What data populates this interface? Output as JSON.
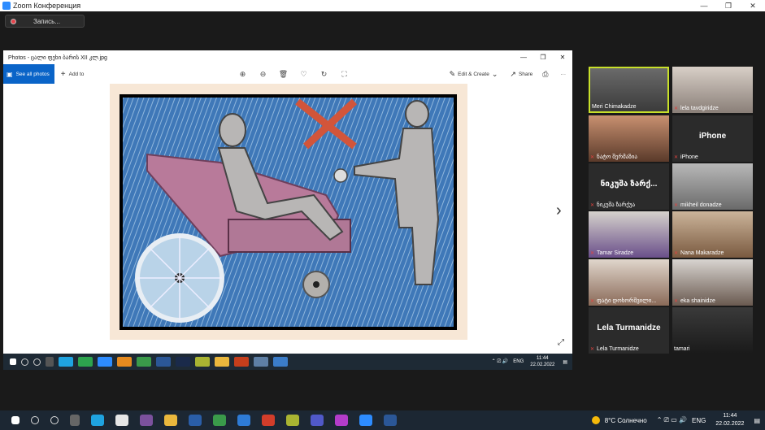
{
  "zoom": {
    "title": "Zoom Конференция",
    "record_label": "Запись...",
    "window_controls": [
      "—",
      "❐",
      "✕"
    ]
  },
  "photos": {
    "title": "Photos - ცალი ფეხი ბარის XII კლ.jpg",
    "window_controls": [
      "—",
      "❐",
      "✕"
    ],
    "see_all_label": "See all photos",
    "add_to_label": "Add to",
    "edit_create_label": "Edit & Create",
    "share_label": "Share",
    "more_label": "···"
  },
  "inner_taskbar": {
    "lang": "ENG",
    "time": "11:44",
    "date": "22.02.2022"
  },
  "participants": [
    {
      "name": "Meri Chimakadze",
      "muted": false,
      "active": true,
      "video": true
    },
    {
      "name": "lela tavdgiridze",
      "muted": true,
      "active": false,
      "video": true
    },
    {
      "name": "ნატო შერმაზია",
      "muted": true,
      "active": false,
      "video": true
    },
    {
      "name": "iPhone",
      "big_label": "iPhone",
      "muted": true,
      "active": false,
      "video": false
    },
    {
      "name": "ნიკუშა ზარქუა",
      "big_label": "ნიკუშა ზარქ...",
      "muted": true,
      "active": false,
      "video": false
    },
    {
      "name": "mikheil donadze",
      "muted": true,
      "active": false,
      "video": true
    },
    {
      "name": "Tamar Siradze",
      "muted": true,
      "active": false,
      "video": true
    },
    {
      "name": "Nana Makaradze",
      "muted": true,
      "active": false,
      "video": true
    },
    {
      "name": "ფატი დოხორშვილი...",
      "muted": true,
      "active": false,
      "video": true
    },
    {
      "name": "eka shainidze",
      "muted": true,
      "active": false,
      "video": true
    },
    {
      "name": "Lela Turmanidze",
      "big_label": "Lela Turmanidze",
      "muted": true,
      "active": false,
      "video": false
    },
    {
      "name": "tamari",
      "muted": false,
      "active": false,
      "video": true
    }
  ],
  "taskbar": {
    "weather": "8°C Солнечно",
    "lang": "ENG",
    "time": "11:44",
    "date": "22.02.2022"
  }
}
